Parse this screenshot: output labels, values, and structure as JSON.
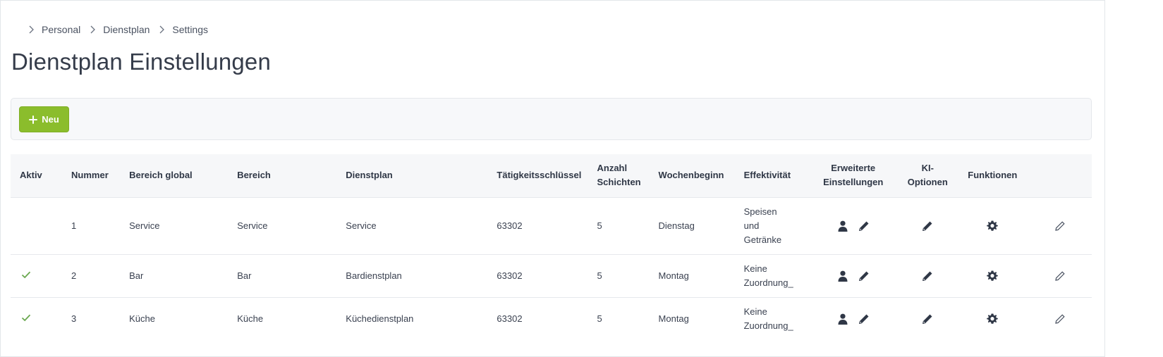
{
  "breadcrumb": {
    "items": [
      "Personal",
      "Dienstplan",
      "Settings"
    ]
  },
  "page": {
    "title": "Dienstplan Einstellungen"
  },
  "toolbar": {
    "new_label": "Neu"
  },
  "table": {
    "headers": {
      "aktiv": "Aktiv",
      "nummer": "Nummer",
      "bereich_global": "Bereich global",
      "bereich": "Bereich",
      "dienstplan": "Dienstplan",
      "taetigkeitsschluessel": "Tätigkeitsschlüssel",
      "anzahl_schichten_1": "Anzahl",
      "anzahl_schichten_2": "Schichten",
      "wochenbeginn": "Wochenbeginn",
      "effektivitaet": "Effektivität",
      "erweiterte_1": "Erweiterte",
      "erweiterte_2": "Einstellungen",
      "ki_1": "KI-",
      "ki_2": "Optionen",
      "funktionen": "Funktionen"
    },
    "rows": [
      {
        "aktiv": false,
        "nummer": "1",
        "bereich_global": "Service",
        "bereich": "Service",
        "dienstplan": "Service",
        "taetigkeitsschluessel": "63302",
        "anzahl_schichten": "5",
        "wochenbeginn": "Dienstag",
        "effektivitaet": [
          "Speisen",
          "und",
          "Getränke"
        ]
      },
      {
        "aktiv": true,
        "nummer": "2",
        "bereich_global": "Bar",
        "bereich": "Bar",
        "dienstplan": "Bardienstplan",
        "taetigkeitsschluessel": "63302",
        "anzahl_schichten": "5",
        "wochenbeginn": "Montag",
        "effektivitaet": [
          "Keine",
          "Zuordnung_"
        ]
      },
      {
        "aktiv": true,
        "nummer": "3",
        "bereich_global": "Küche",
        "bereich": "Küche",
        "dienstplan": "Küchedienstplan",
        "taetigkeitsschluessel": "63302",
        "anzahl_schichten": "5",
        "wochenbeginn": "Montag",
        "effektivitaet": [
          "Keine",
          "Zuordnung_"
        ]
      }
    ]
  },
  "icons": {
    "chevron": "chevron-right-icon",
    "plus": "plus-icon",
    "check": "check-icon",
    "user": "user-icon",
    "pencil": "pencil-icon",
    "gear": "gear-icon",
    "edit": "edit-outline-icon"
  },
  "colors": {
    "primary_button": "#8bbd2c",
    "active_check": "#6aa84f",
    "text_dark": "#2f3746",
    "header_bg": "#f6f7f9"
  }
}
